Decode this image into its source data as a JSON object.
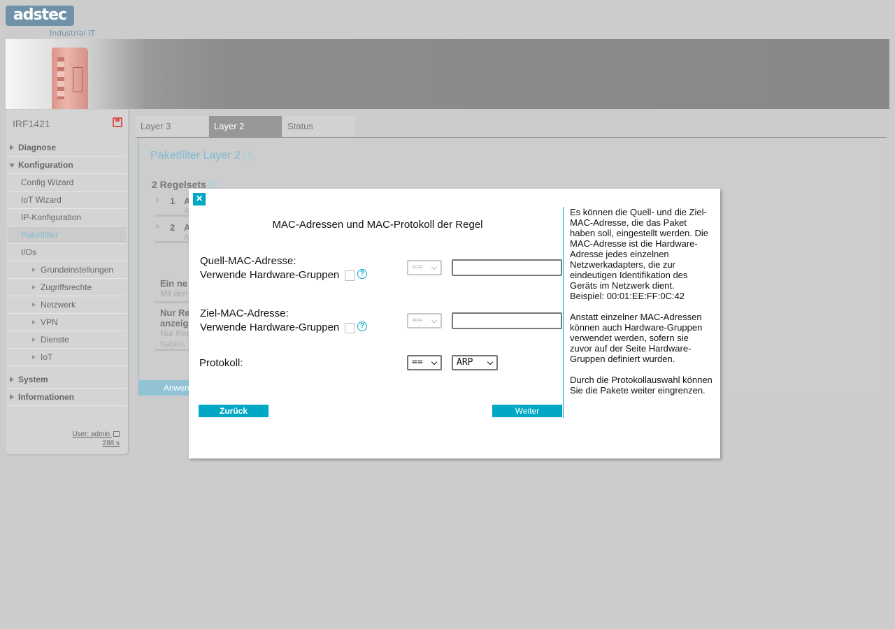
{
  "header": {
    "logo": "adstec",
    "logo_sub": "Industrial IT"
  },
  "sidebar": {
    "device_name": "IRF1421",
    "items": [
      {
        "label": "Diagnose"
      },
      {
        "label": "Konfiguration"
      },
      {
        "label": "Config Wizard"
      },
      {
        "label": "IoT Wizard"
      },
      {
        "label": "IP-Konfiguration"
      },
      {
        "label": "Paketfilter"
      },
      {
        "label": "I/Os"
      },
      {
        "label": "Grundeinstellungen"
      },
      {
        "label": "Zugriffsrechte"
      },
      {
        "label": "Netzwerk"
      },
      {
        "label": "VPN"
      },
      {
        "label": "Dienste"
      },
      {
        "label": "IoT"
      },
      {
        "label": "System"
      },
      {
        "label": "Informationen"
      }
    ],
    "user": "User: admin",
    "timer": "288 s"
  },
  "tabs": [
    {
      "label": "Layer 3"
    },
    {
      "label": "Layer 2"
    },
    {
      "label": "Status"
    }
  ],
  "main": {
    "title": "Paketfilter Layer 2",
    "rulesets_title": "2 Regelsets",
    "rulesets": [
      {
        "num": "1",
        "name": "A",
        "sub": "A"
      },
      {
        "num": "2",
        "name": "A",
        "sub": "A"
      }
    ],
    "info1": {
      "title": "Ein ne",
      "desc": "Mit den"
    },
    "info2": {
      "title1": "Nur Re",
      "title2": "anzeig",
      "desc1": "Nur Reg",
      "desc2": "haben,"
    },
    "apply": "Anwen"
  },
  "modal": {
    "title": "MAC-Adressen und MAC-Protokoll der Regel",
    "source_label": "Quell-MAC-Adresse:",
    "source_hw": "Verwende Hardware-Gruppen",
    "source_op": "==",
    "source_value": "",
    "dest_label": "Ziel-MAC-Adresse:",
    "dest_hw": "Verwende Hardware-Gruppen",
    "dest_op": "==",
    "dest_value": "",
    "protocol_label": "Protokoll:",
    "protocol_op": "==",
    "protocol_value": "ARP",
    "back": "Zurück",
    "next": "Weiter",
    "help_text": "Es können die Quell- und die Ziel-MAC-Adresse, die das Paket haben soll, eingestellt werden. Die MAC-Adresse ist die Hardware-Adresse jedes einzelnen Netzwerkadapters, die zur eindeutigen Identifikation des Geräts im Netzwerk dient.\nBeispiel: 00:01:EE:FF:0C:42\n\nAnstatt einzelner MAC-Adressen können auch Hardware-Gruppen verwendet werden, sofern sie zuvor auf der Seite Hardware-Gruppen definiert wurden.\n\nDurch die Protokollauswahl können Sie die Pakete weiter eingrenzen."
  },
  "colors": {
    "accent": "#00a8c6",
    "accent_light": "#7fbcd3",
    "save_red": "#d9534f"
  }
}
